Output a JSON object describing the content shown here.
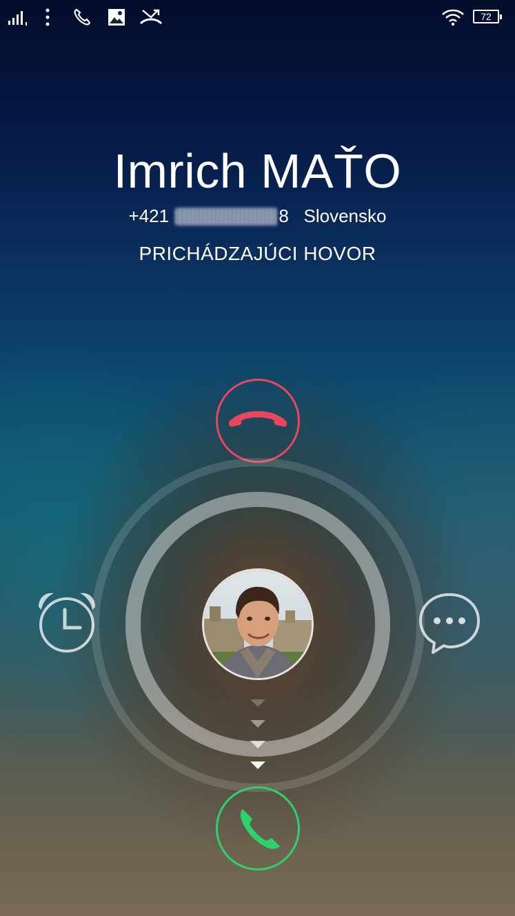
{
  "status_bar": {
    "icons": [
      "signal-icon",
      "overflow-menu-icon",
      "phone-icon",
      "image-icon",
      "missed-call-icon",
      "wifi-icon"
    ],
    "battery_level": "72"
  },
  "caller": {
    "name": "Imrich MAŤO",
    "number_prefix": "+421",
    "number_suffix": "8",
    "region": "Slovensko"
  },
  "call_status": "PRICHÁDZAJÚCI HOVOR",
  "controls": {
    "decline_icon": "hang-up-icon",
    "answer_icon": "phone-answer-icon",
    "remind_icon": "alarm-clock-icon",
    "message_icon": "message-bubble-icon"
  },
  "colors": {
    "decline": "#e8475e",
    "answer": "#2fd16a"
  }
}
